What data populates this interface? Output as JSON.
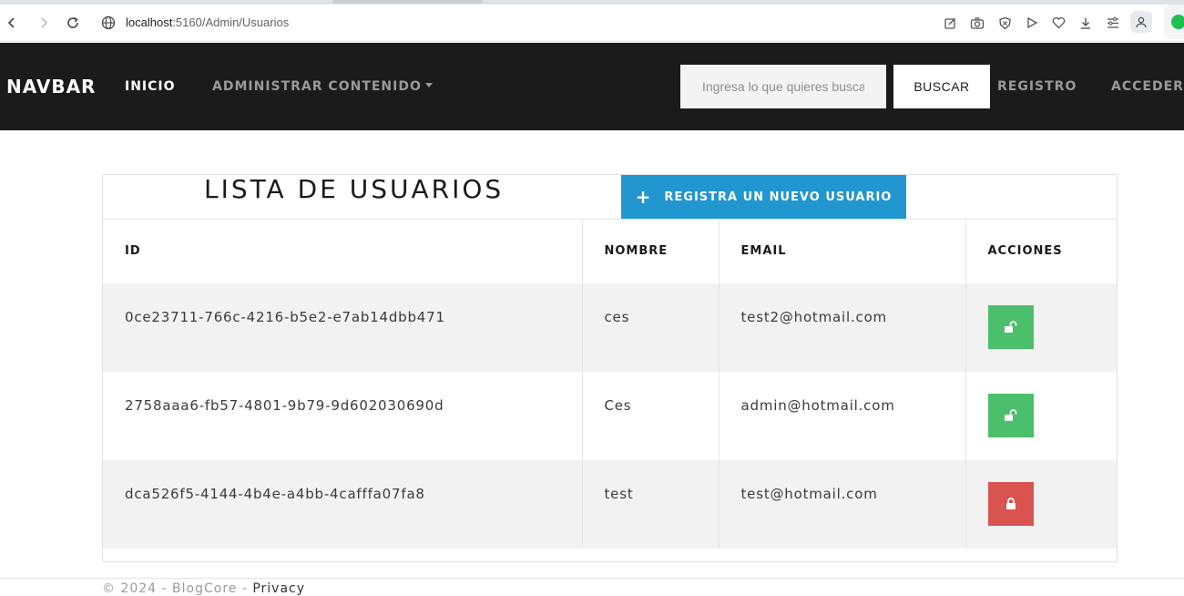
{
  "browser": {
    "url_host": "localhost",
    "url_path": ":5160/Admin/Usuarios",
    "icons": [
      "back-icon",
      "forward-icon",
      "reload-icon",
      "site-info-icon",
      "edit-icon",
      "camera-icon",
      "shield-icon",
      "play-icon",
      "heart-icon",
      "download-icon",
      "menu-icon",
      "profile-icon",
      "extension-check-icon"
    ]
  },
  "navbar": {
    "brand": "NAVBAR",
    "links": [
      {
        "label": "INICIO"
      },
      {
        "label": "ADMINISTRAR CONTENIDO"
      }
    ],
    "search_placeholder": "Ingresa lo que quieres buscar",
    "search_button": "BUSCAR",
    "register": "REGISTRO",
    "login": "ACCEDER"
  },
  "page": {
    "title": "LISTA DE USUARIOS",
    "new_user_button": "REGISTRA UN NUEVO USUARIO",
    "table": {
      "headers": [
        "ID",
        "NOMBRE",
        "EMAIL",
        "ACCIONES"
      ],
      "rows": [
        {
          "id": "0ce23711-766c-4216-b5e2-e7ab14dbb471",
          "nombre": "ces",
          "email": "test2@hotmail.com",
          "action": "unlock-icon",
          "action_color": "#4bbf6b"
        },
        {
          "id": "2758aaa6-fb57-4801-9b79-9d602030690d",
          "nombre": "Ces",
          "email": "admin@hotmail.com",
          "action": "unlock-icon",
          "action_color": "#4bbf6b"
        },
        {
          "id": "dca526f5-4144-4b4e-a4bb-4cafffa07fa8",
          "nombre": "test",
          "email": "test@hotmail.com",
          "action": "lock-icon",
          "action_color": "#d9534f"
        }
      ]
    }
  },
  "footer": {
    "text": "© 2024 - BlogCore - ",
    "link": "Privacy"
  },
  "colors": {
    "navbar_bg": "#1b1b1b",
    "primary_button": "#2196cf",
    "unlock_green": "#4bbf6b",
    "lock_red": "#d9534f"
  }
}
